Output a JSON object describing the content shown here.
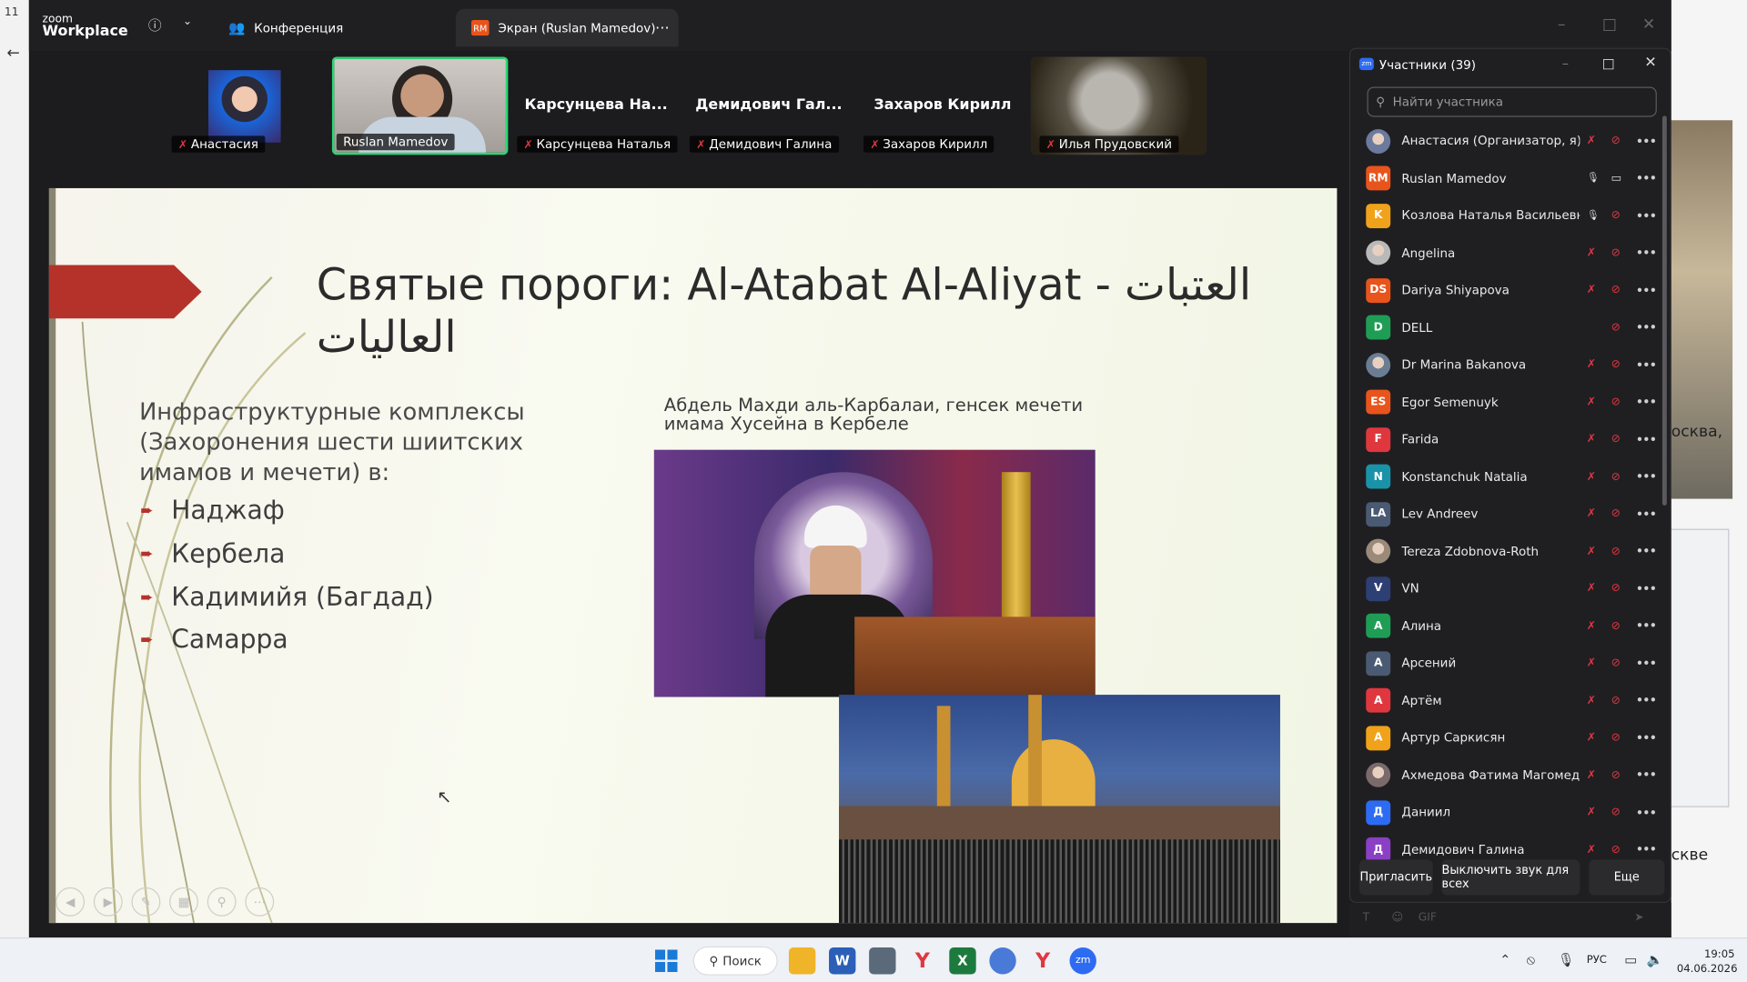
{
  "browser": {
    "tab_num": "11",
    "side_text1": "осква,",
    "side_text2": "скве"
  },
  "zoom": {
    "brand_small": "zoom",
    "brand_big": "Workplace",
    "tabs": [
      {
        "label": "Конференция"
      },
      {
        "label": "Экран (Ruslan Mamedov)",
        "badge": "RM"
      }
    ]
  },
  "gallery": [
    {
      "name": "Анастасия",
      "title": "",
      "video": true
    },
    {
      "name": "Ruslan Mamedov",
      "title": "",
      "video": true,
      "active": true
    },
    {
      "name": "Карсунцева Наталья",
      "title": "Карсунцева  На...",
      "video": false
    },
    {
      "name": "Демидович Галина",
      "title": "Демидович  Гал...",
      "video": false
    },
    {
      "name": "Захаров Кирилл",
      "title": "Захаров Кирилл",
      "video": false
    },
    {
      "name": "Илья Прудовский",
      "title": "",
      "video": true
    }
  ],
  "slide": {
    "title_line1": "Святые пороги: Al-Atabat Al-Aliyat -  العتبات",
    "title_line2": "العاليات",
    "intro": "Инфраструктурные комплексы (Захоронения шести шиитских имамов и мечети) в:",
    "bullets": [
      "Наджаф",
      "Кербела",
      "Кадимийя (Багдад)",
      "Самарра"
    ],
    "caption": "Абдель Махди аль-Карбалаи, генсек мечети имама Хусейна в Кербеле"
  },
  "participants": {
    "title": "Участники (39)",
    "search_placeholder": "Найти участника",
    "items": [
      {
        "initials": "",
        "name": "Анастасия (Организатор, я)",
        "color": "#6b7a9e",
        "photo": true
      },
      {
        "initials": "RM",
        "name": "Ruslan Mamedov",
        "color": "#e8541c",
        "mic_on": true,
        "video_on": true
      },
      {
        "initials": "K",
        "name": "Козлова Наталья Васильевна",
        "color": "#f0a21a",
        "mic_on": true
      },
      {
        "initials": "",
        "name": "Angelina",
        "color": "#b9b9b9",
        "photo": true
      },
      {
        "initials": "DS",
        "name": "Dariya Shiyapova",
        "color": "#e8541c"
      },
      {
        "initials": "D",
        "name": "DELL",
        "color": "#1f9d55"
      },
      {
        "initials": "",
        "name": "Dr Marina Bakanova",
        "color": "#6a7d93",
        "photo": true
      },
      {
        "initials": "ES",
        "name": "Egor Semenuyk",
        "color": "#e8541c"
      },
      {
        "initials": "F",
        "name": "Farida",
        "color": "#e0373f"
      },
      {
        "initials": "N",
        "name": "Konstanchuk Natalia",
        "color": "#1a93a8"
      },
      {
        "initials": "LA",
        "name": "Lev Andreev",
        "color": "#4a5a73"
      },
      {
        "initials": "",
        "name": "Tereza Zdobnova-Roth",
        "color": "#9b8a7a",
        "photo": true
      },
      {
        "initials": "V",
        "name": "VN",
        "color": "#2d3f73"
      },
      {
        "initials": "A",
        "name": "Алина",
        "color": "#1f9d55"
      },
      {
        "initials": "A",
        "name": "Арсений",
        "color": "#4a5a73"
      },
      {
        "initials": "A",
        "name": "Артём",
        "color": "#e0373f"
      },
      {
        "initials": "A",
        "name": "Артур Саркисян",
        "color": "#f0a21a"
      },
      {
        "initials": "",
        "name": "Ахмедова Фатима Магомедов...",
        "color": "#7a6a6a",
        "photo": true
      },
      {
        "initials": "Д",
        "name": "Даниил",
        "color": "#2d6cf2"
      },
      {
        "initials": "Д",
        "name": "Демидович Галина",
        "color": "#8a3fc4"
      }
    ],
    "buttons": {
      "invite": "Пригласить",
      "mute_all": "Выключить звук для всех",
      "more": "Еще"
    }
  },
  "taskbar": {
    "search_label": "Поиск",
    "lang": "РУС",
    "time": "19:05",
    "date": "04.06.2026"
  }
}
